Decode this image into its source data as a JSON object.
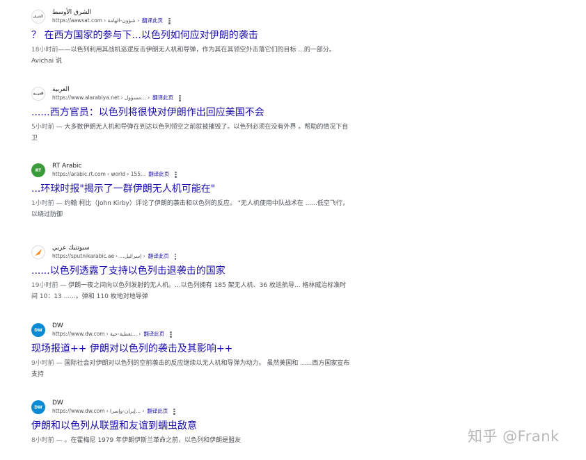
{
  "results": [
    {
      "site_name": "الشرق الأوسط",
      "url": "https://aawsat.com",
      "path": "› شؤون-الهامة ›",
      "translate_label": "翻译此页",
      "favicon_text": "الشرق",
      "favicon_color": "#ffffff",
      "favicon_fg": "#1a1a1a",
      "title": "？ 在西方国家的参与下...以色列如何应对伊朗的袭击",
      "snippet_age": "18小时前",
      "snippet": "——以色列利用其战机巡逻反击伊朗无人机和导弹，作为其在其领空外击落它们的目标 ...的一部分。 Avichai 说"
    },
    {
      "site_name": "العربية",
      "url": "https://www.alarabiya.net",
      "path": "› مسؤول... ›",
      "translate_label": "翻译此页",
      "favicon_text": "العربية",
      "favicon_color": "#ffffff",
      "favicon_fg": "#1a1a1a",
      "title": "......西方官员：以色列将很快对伊朗作出回应美国不会",
      "snippet_age": "5小时前",
      "snippet": " — 大多数伊朗无人机和导弹在到达以色列领空之前就被摧毁了。以色列必须在没有外界 。帮助的情况下自卫"
    },
    {
      "site_name": "RT Arabic",
      "url": "https://arabic.rt.com",
      "path": "› world › 155...",
      "translate_label": "翻译此页",
      "favicon_text": "RT",
      "favicon_color": "#3a9b3a",
      "favicon_fg": "#ffffff",
      "title": "...环球时报\"揭示了一群伊朗无人机可能在\"",
      "snippet_age": "1小时前",
      "snippet": " — 约翰 柯比（John Kirby）评论了伊朗的袭击和以色列的反应。 \"无人机使用中队战术在 ......低空飞行，以绕过防御"
    },
    {
      "site_name": "سبوتنيك عربي",
      "url": "https://sputnikarabic.ae",
      "path": "› ...إسرائيل ›",
      "translate_label": "翻译此页",
      "favicon_text": "",
      "favicon_color": "#ffffff",
      "favicon_fg": "#f28c28",
      "title": "......以色列透露了支持以色列击退袭击的国家",
      "snippet_age": "19小时前",
      "snippet": " — 伊朗一夜之间向以色列发射的无人机。...以色列拥有 185 架无人机、36 枚巡航导... 格林威治标准时间 10：13 ......。弹和 110 枚地对地导弹"
    },
    {
      "site_name": "DW",
      "url": "https://www.dw.com",
      "path": "› تغطية-حية... ›",
      "translate_label": "翻译此页",
      "favicon_text": "DW",
      "favicon_color": "#0b8ad3",
      "favicon_fg": "#ffffff",
      "title": "现场报道++ 伊朗对以色列的袭击及其影响++",
      "snippet_age": "9小时前",
      "snippet": " — 国际社会对伊朗对以色列的空前袭击的反应继续以无人机和导弹为动力。 虽然美国和 ......西方国家宣布支持"
    },
    {
      "site_name": "DW",
      "url": "https://www.dw.com",
      "path": "› إيران-وإسرا... ›",
      "translate_label": "翻译此页",
      "favicon_text": "DW",
      "favicon_color": "#0b8ad3",
      "favicon_fg": "#ffffff",
      "title": "伊朗和以色列从联盟和友谊到蠕虫敌意",
      "snippet_age": "8小时前",
      "snippet": " — 。在霍梅尼 1979 年伊朗伊斯兰革命之前，以色列和伊朗是盟友"
    }
  ],
  "watermark": "知乎 @Frank"
}
